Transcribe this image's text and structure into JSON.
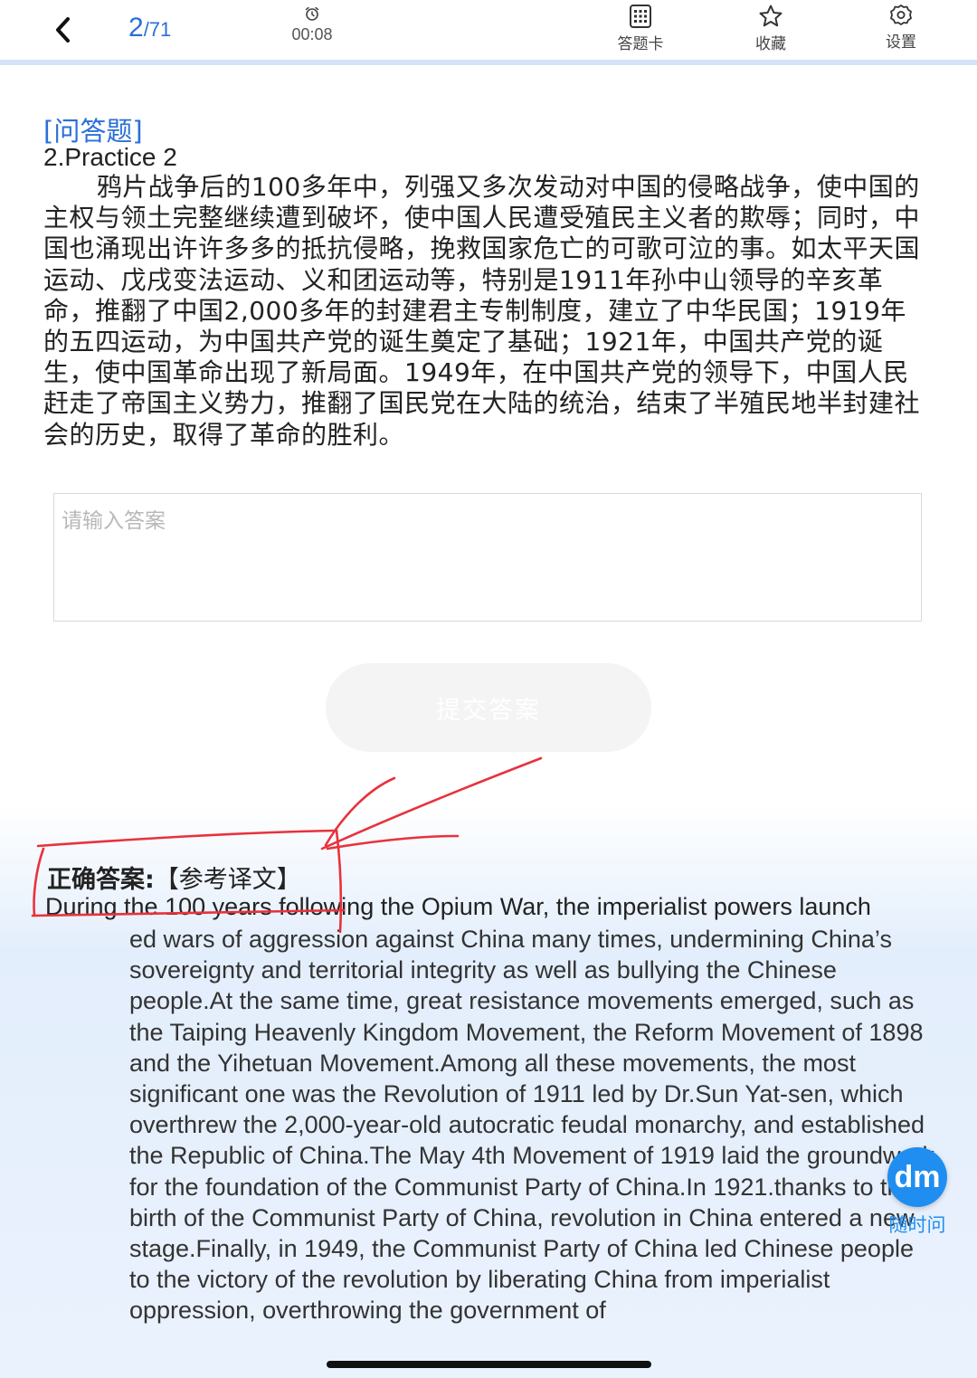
{
  "header": {
    "back_icon": "chevron-left-icon",
    "counter_current": "2",
    "counter_total": "/71",
    "timer": "00:08",
    "answer_card_label": "答题卡",
    "favorite_label": "收藏",
    "settings_label": "设置",
    "accent_color": "#2a6fd8"
  },
  "question": {
    "type_label": "[问答题]",
    "title": "2.Practice 2",
    "body": "鸦片战争后的100多年中，列强又多次发动对中国的侵略战争，使中国的主权与领土完整继续遭到破坏，使中国人民遭受殖民主义者的欺辱；同时，中国也涌现出许许多多的抵抗侵略，挽救国家危亡的可歌可泣的事。如太平天国运动、戊戌变法运动、义和团运动等，特别是1911年孙中山领导的辛亥革命，推翻了中国2,000多年的封建君主专制制度，建立了中华民国；1919年的五四运动，为中国共产党的诞生奠定了基础；1921年，中国共产党的诞生，使中国革命出现了新局面。1949年，在中国共产党的领导下，中国人民赶走了帝国主义势力，推翻了国民党在大陆的统治，结束了半殖民地半封建社会的历史，取得了革命的胜利。",
    "answer_placeholder": "请输入答案",
    "submit_label": "提交答案"
  },
  "answer": {
    "label_bold": "正确答案:",
    "label_rest": "【参考译文】",
    "first_line": "During the 100 years following the Opium War, the imperialist powers launch",
    "body": "ed wars of aggression against China many times, undermining China’s sovereignty and territorial integrity as well as bullying the Chinese people.At the same time, great resistance movements emerged, such as the Taiping Heavenly Kingdom Movement, the Reform Movement of 1898 and the Yihetuan Movement.Among all these movements, the most significant one was the Revolution of 1911 led by Dr.Sun Yat-sen, which overthrew the 2,000-year-old autocratic feudal monarchy, and established the Republic of China.The May 4th Movement of 1919 laid the groundwork for the foundation of the Communist Party of China.In 1921.thanks to the birth of the Communist Party of China, revolution in China entered a new stage.Finally, in 1949, the Communist Party of China led Chinese people to the victory of the revolution by liberating China from imperialist oppression, overthrowing the government of"
  },
  "assistant": {
    "logo_text": "dm",
    "label": "随时问",
    "color": "#1f8ef0"
  },
  "annotation_color": "#e8323c"
}
